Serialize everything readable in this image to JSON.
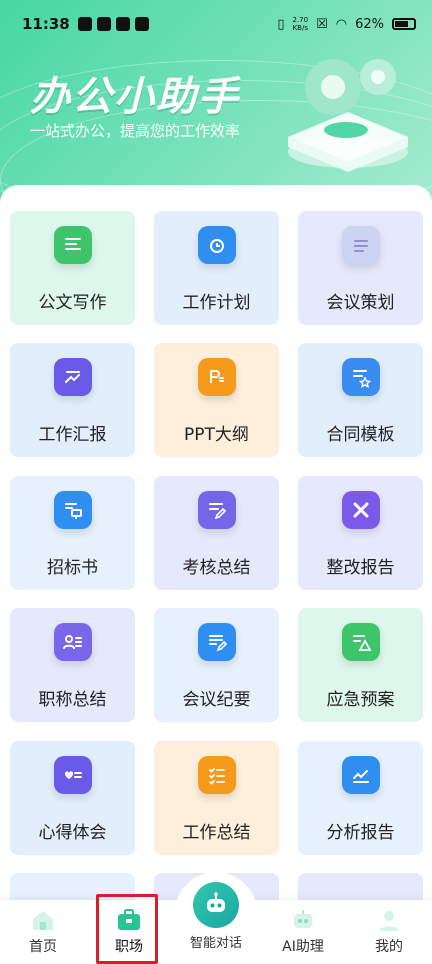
{
  "status_bar": {
    "time": "11:38",
    "speed_value": "2.70",
    "speed_unit": "KB/s",
    "battery": "62%"
  },
  "banner": {
    "title": "办公小助手",
    "subtitle": "一站式办公，提高您的工作效率"
  },
  "tools": [
    {
      "label": "公文写作",
      "icon": "document-list-icon",
      "color": "#3ec46a"
    },
    {
      "label": "工作计划",
      "icon": "clock-bookmark-icon",
      "color": "#2f8ff0"
    },
    {
      "label": "会议策划",
      "icon": "meeting-doc-icon",
      "color": "#c9cfee"
    },
    {
      "label": "工作汇报",
      "icon": "trend-report-icon",
      "color": "#6a5ae8"
    },
    {
      "label": "PPT大纲",
      "icon": "ppt-icon",
      "color": "#f59a1b"
    },
    {
      "label": "合同模板",
      "icon": "contract-star-icon",
      "color": "#3a8cf0"
    },
    {
      "label": "招标书",
      "icon": "bid-doc-icon",
      "color": "#2f8ff0"
    },
    {
      "label": "考核总结",
      "icon": "edit-doc-icon",
      "color": "#7566e8"
    },
    {
      "label": "整改报告",
      "icon": "tools-icon",
      "color": "#7a5ae8"
    },
    {
      "label": "职称总结",
      "icon": "id-card-icon",
      "color": "#7a66e8"
    },
    {
      "label": "会议纪要",
      "icon": "minutes-pen-icon",
      "color": "#2f8ff0"
    },
    {
      "label": "应急预案",
      "icon": "warning-doc-icon",
      "color": "#3ec46a"
    },
    {
      "label": "心得体会",
      "icon": "heart-note-icon",
      "color": "#6a5ae8"
    },
    {
      "label": "工作总结",
      "icon": "checklist-icon",
      "color": "#f59a1b"
    },
    {
      "label": "分析报告",
      "icon": "chart-line-icon",
      "color": "#2f8ff0"
    }
  ],
  "tabbar": {
    "home": "首页",
    "workplace": "职场",
    "chat": "智能对话",
    "ai_assistant": "AI助理",
    "mine": "我的"
  }
}
